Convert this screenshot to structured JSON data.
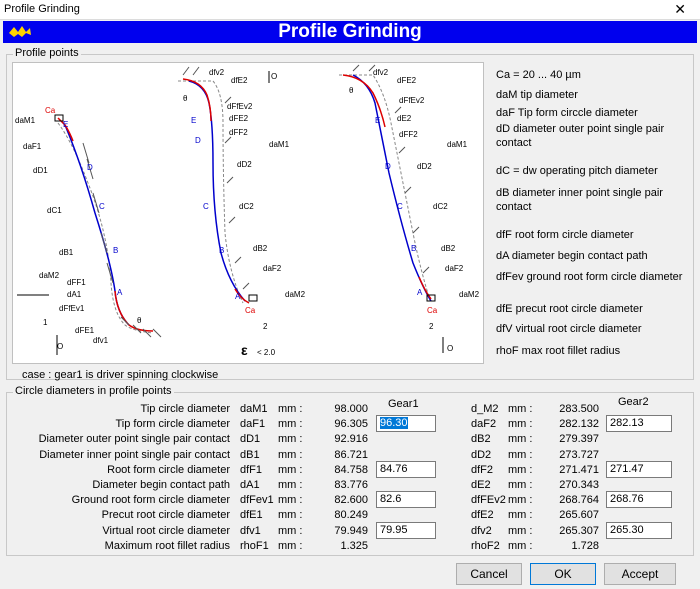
{
  "window": {
    "title": "Profile Grinding",
    "close_glyph": "✕"
  },
  "banner": {
    "title": "Profile Grinding"
  },
  "profile_group": {
    "legend": "Profile points",
    "figure": {
      "labels": {
        "ca": "Ca",
        "damt": "d",
        "e": "E",
        "d": "D",
        "c": "C",
        "b": "B",
        "a": "A",
        "one": "1",
        "two": "2",
        "o1": "O",
        "o2": "O",
        "epsilon": "ε",
        "eps_val": "< 2.0",
        "theta": "θ"
      },
      "fig1": [
        "daM1",
        "daF1",
        "dD1",
        "dC1",
        "dB1",
        "daM2",
        "dFF1",
        "dA1",
        "dFfEv1",
        "dFE1",
        "dfv1"
      ],
      "fig2": [
        "dfv2",
        "dfE2",
        "dFfEv2",
        "dFE2",
        "dFF2",
        "daM1",
        "dD2",
        "dC2",
        "dB2",
        "daF2",
        "daM2"
      ],
      "fig3": [
        "dfv2",
        "dFE2",
        "dFfEv2",
        "dE2",
        "dFF2",
        "daM1",
        "dD2",
        "dC2",
        "dB2",
        "daF2",
        "daM2"
      ]
    },
    "abbreviations": [
      "Ca = 20 ... 40 µm",
      "daM  tip diameter",
      "daF  Tip form circcle diameter",
      "dD  diameter outer point single pair contact",
      "dC = dw  operating pitch diameter",
      "dB  diameter inner point single pair contact",
      "dfF  root form circle diameter",
      "dA  diameter begin contact path",
      "dfFev  ground root form circle diameter",
      "dfE  precut root circle diameter",
      "dfV  virtual root circle diameter",
      "rhoF  max root fillet radius"
    ],
    "case_text": "case : gear1 is driver spinning clockwise"
  },
  "circle_group": {
    "legend": "Circle diameters in profile points",
    "gear1_header": "Gear1",
    "gear2_header": "Gear2",
    "rows": [
      {
        "desc": "Tip circle diameter",
        "sym1": "daM1",
        "unit": "mm :",
        "val1": "98.000",
        "inp1": "",
        "sym2": "d_M2",
        "unit2": "mm :",
        "val2": "283.500",
        "inp2": ""
      },
      {
        "desc": "Tip form circle diameter",
        "sym1": "daF1",
        "unit": "mm :",
        "val1": "96.305",
        "inp1": "96.30",
        "sym2": "daF2",
        "unit2": "mm :",
        "val2": "282.132",
        "inp2": "282.13"
      },
      {
        "desc": "Diameter outer point single pair contact",
        "sym1": "dD1",
        "unit": "mm :",
        "val1": "92.916",
        "inp1": "",
        "sym2": "dB2",
        "unit2": "mm :",
        "val2": "279.397",
        "inp2": ""
      },
      {
        "desc": "Diameter inner point single pair contact",
        "sym1": "dB1",
        "unit": "mm :",
        "val1": "86.721",
        "inp1": "",
        "sym2": "dD2",
        "unit2": "mm :",
        "val2": "273.727",
        "inp2": ""
      },
      {
        "desc": "Root form circle diameter",
        "sym1": "dfF1",
        "unit": "mm :",
        "val1": "84.758",
        "inp1": "84.76",
        "sym2": "dfF2",
        "unit2": "mm :",
        "val2": "271.471",
        "inp2": "271.47"
      },
      {
        "desc": "Diameter begin contact path",
        "sym1": "dA1",
        "unit": "mm :",
        "val1": "83.776",
        "inp1": "",
        "sym2": "dE2",
        "unit2": "mm :",
        "val2": "270.343",
        "inp2": ""
      },
      {
        "desc": "Ground root form circle diameter",
        "sym1": "dfFev1",
        "unit": "mm :",
        "val1": "82.600",
        "inp1": "82.6",
        "sym2": "dfFEv2",
        "unit2": "mm :",
        "val2": "268.764",
        "inp2": "268.76"
      },
      {
        "desc": "Precut root circle diameter",
        "sym1": "dfE1",
        "unit": "mm :",
        "val1": "80.249",
        "inp1": "",
        "sym2": "dfE2",
        "unit2": "mm :",
        "val2": "265.607",
        "inp2": ""
      },
      {
        "desc": "Virtual root circle diameter",
        "sym1": "dfv1",
        "unit": "mm :",
        "val1": "79.949",
        "inp1": "79.95",
        "sym2": "dfv2",
        "unit2": "mm :",
        "val2": "265.307",
        "inp2": "265.30"
      },
      {
        "desc": "Maximum root fillet radius",
        "sym1": "rhoF1",
        "unit": "mm :",
        "val1": "1.325",
        "inp1": "",
        "sym2": "rhoF2",
        "unit2": "mm :",
        "val2": "1.728",
        "inp2": ""
      }
    ]
  },
  "buttons": {
    "cancel": "Cancel",
    "ok": "OK",
    "accept": "Accept"
  }
}
